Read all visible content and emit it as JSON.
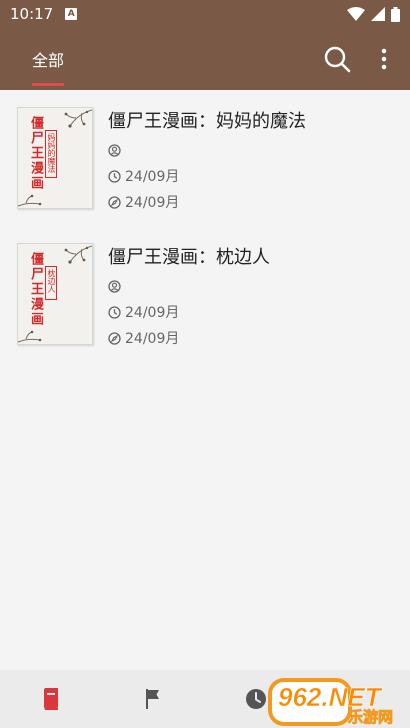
{
  "status_bar": {
    "time": "10:17",
    "icons": [
      "a-icon",
      "wifi-icon",
      "signal-icon",
      "battery-icon"
    ]
  },
  "app_bar": {
    "tabs": [
      {
        "label": "全部",
        "selected": true
      }
    ],
    "icons": [
      "search-icon",
      "more-vert-icon"
    ]
  },
  "colors": {
    "app_bar": "#7a5a47",
    "tab_indicator": "#e14b4b",
    "cover_text": "#d42a2a",
    "bottom_nav_active": "#d9363e"
  },
  "books": [
    {
      "title": "僵尸王漫画：妈妈的魔法",
      "author": "",
      "updated": "24/09月",
      "read": "24/09月",
      "cover": {
        "big_text": "僵尸王漫画",
        "small_text": "妈妈的魔法"
      }
    },
    {
      "title": "僵尸王漫画：枕边人",
      "author": "",
      "updated": "24/09月",
      "read": "24/09月",
      "cover": {
        "big_text": "僵尸王漫画",
        "small_text": "枕边人"
      }
    }
  ],
  "bottom_nav": {
    "items": [
      "book-icon",
      "flag-icon",
      "clock-icon"
    ],
    "active": 0
  },
  "watermark": {
    "line1": "962.NET",
    "line2": "乐游网"
  }
}
